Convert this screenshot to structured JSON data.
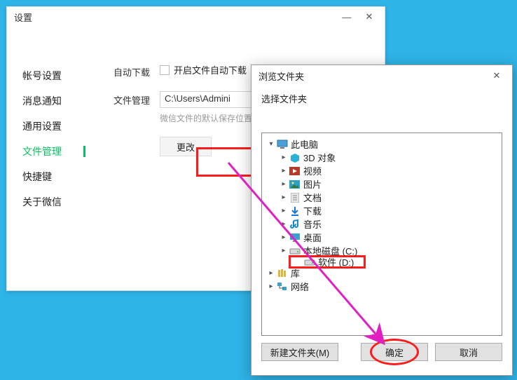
{
  "settings": {
    "title": "设置",
    "sidebar": [
      {
        "label": "帐号设置",
        "active": false
      },
      {
        "label": "消息通知",
        "active": false
      },
      {
        "label": "通用设置",
        "active": false
      },
      {
        "label": "文件管理",
        "active": true
      },
      {
        "label": "快捷键",
        "active": false
      },
      {
        "label": "关于微信",
        "active": false
      }
    ],
    "content": {
      "autoDownload": {
        "label": "自动下载",
        "checkboxLabel": "开启文件自动下载"
      },
      "fileManage": {
        "label": "文件管理",
        "path": "C:\\Users\\Admini",
        "hint": "微信文件的默认保存位置",
        "changeBtn": "更改"
      }
    },
    "minimizeGlyph": "—",
    "closeGlyph": "✕"
  },
  "browse": {
    "title": "浏览文件夹",
    "subtitle": "选择文件夹",
    "closeGlyph": "✕",
    "tree": [
      {
        "indent": 0,
        "arrow": "down",
        "icon": "pc",
        "label": "此电脑"
      },
      {
        "indent": 1,
        "arrow": "right",
        "icon": "3d",
        "label": "3D 对象"
      },
      {
        "indent": 1,
        "arrow": "right",
        "icon": "video",
        "label": "视频"
      },
      {
        "indent": 1,
        "arrow": "right",
        "icon": "picture",
        "label": "图片"
      },
      {
        "indent": 1,
        "arrow": "right",
        "icon": "doc",
        "label": "文档"
      },
      {
        "indent": 1,
        "arrow": "right",
        "icon": "download",
        "label": "下载"
      },
      {
        "indent": 1,
        "arrow": "right",
        "icon": "music",
        "label": "音乐"
      },
      {
        "indent": 1,
        "arrow": "right",
        "icon": "desktop",
        "label": "桌面"
      },
      {
        "indent": 1,
        "arrow": "right",
        "icon": "drive",
        "label": "本地磁盘 (C:)"
      },
      {
        "indent": 1,
        "arrow": "none",
        "icon": "drive",
        "label": "软件 (D:)",
        "selected": true
      },
      {
        "indent": 0,
        "arrow": "right",
        "icon": "library",
        "label": "库"
      },
      {
        "indent": 0,
        "arrow": "right",
        "icon": "network",
        "label": "网络"
      }
    ],
    "buttons": {
      "newFolder": "新建文件夹(M)",
      "ok": "确定",
      "cancel": "取消"
    }
  },
  "annotationColor": "#e020c0"
}
